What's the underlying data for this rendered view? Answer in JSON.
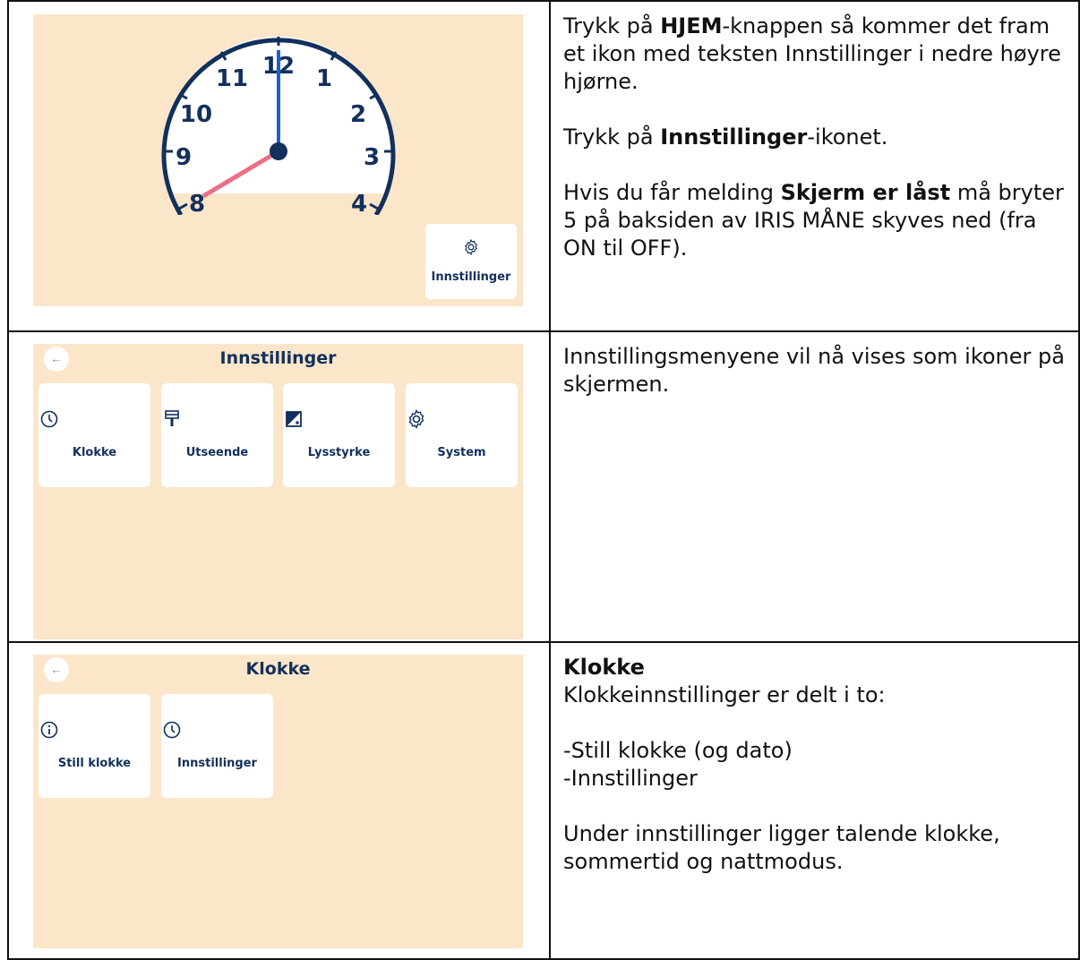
{
  "row1": {
    "clock_numbers": [
      "12",
      "1",
      "2",
      "3",
      "4",
      "8",
      "9",
      "10",
      "11"
    ],
    "settings_label": "Innstillinger",
    "para1_a": "Trykk på ",
    "para1_b": "HJEM",
    "para1_c": "-knappen så kommer det fram et ikon med teksten Innstillinger i nedre høyre hjørne.",
    "para2_a": "Trykk på ",
    "para2_b": "Innstillinger",
    "para2_c": "-ikonet.",
    "para3_a": "Hvis du får melding ",
    "para3_b": "Skjerm er låst",
    "para3_c": " må bryter 5 på baksiden av IRIS MÅNE skyves ned (fra ON til OFF)."
  },
  "row2": {
    "back": "←",
    "title": "Innstillinger",
    "tiles": [
      {
        "label": "Klokke",
        "icon": "clock-icon"
      },
      {
        "label": "Utseende",
        "icon": "paint-roller-icon"
      },
      {
        "label": "Lysstyrke",
        "icon": "brightness-icon"
      },
      {
        "label": "System",
        "icon": "gear-icon"
      }
    ],
    "text": "Innstillingsmenyene vil nå vises som ikoner på skjermen."
  },
  "row3": {
    "back": "←",
    "title": "Klokke",
    "tiles": [
      {
        "label": "Still klokke",
        "icon": "info-icon"
      },
      {
        "label": "Innstillinger",
        "icon": "clock-icon"
      }
    ],
    "heading": "Klokke",
    "line1": "Klokkeinnstillinger er delt i to:",
    "line2": "-Still klokke (og dato)",
    "line3": "-Innstillinger",
    "line4": "Under innstillinger ligger talende klokke, sommertid og nattmodus."
  },
  "colors": {
    "screen_bg": "#fce6c9",
    "navy": "#12305c",
    "hour_hand": "#1a5fd6",
    "minute_hand": "#ec6f86"
  }
}
